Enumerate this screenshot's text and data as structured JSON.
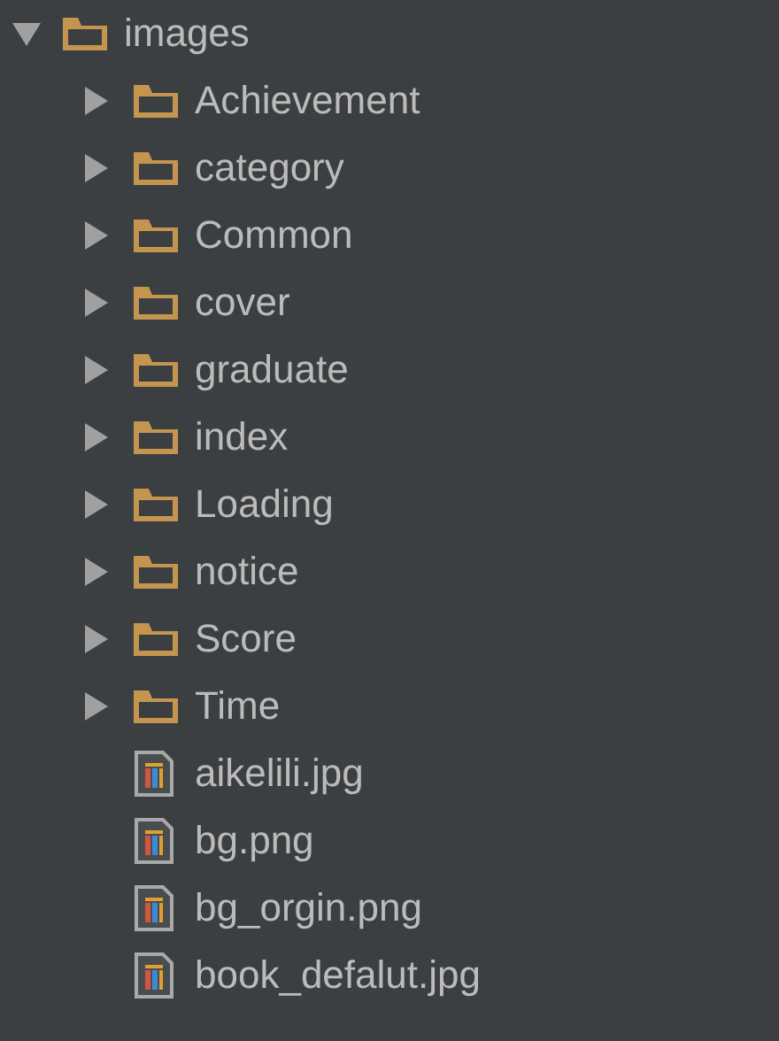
{
  "tree": [
    {
      "name": "images",
      "kind": "folder",
      "expanded": true,
      "children": [
        {
          "name": "Achievement",
          "kind": "folder",
          "expanded": false
        },
        {
          "name": "category",
          "kind": "folder",
          "expanded": false
        },
        {
          "name": "Common",
          "kind": "folder",
          "expanded": false
        },
        {
          "name": "cover",
          "kind": "folder",
          "expanded": false
        },
        {
          "name": "graduate",
          "kind": "folder",
          "expanded": false
        },
        {
          "name": "index",
          "kind": "folder",
          "expanded": false
        },
        {
          "name": "Loading",
          "kind": "folder",
          "expanded": false
        },
        {
          "name": "notice",
          "kind": "folder",
          "expanded": false
        },
        {
          "name": "Score",
          "kind": "folder",
          "expanded": false
        },
        {
          "name": "Time",
          "kind": "folder",
          "expanded": false
        },
        {
          "name": "aikelili.jpg",
          "kind": "file"
        },
        {
          "name": "bg.png",
          "kind": "file"
        },
        {
          "name": "bg_orgin.png",
          "kind": "file"
        },
        {
          "name": "book_defalut.jpg",
          "kind": "file"
        }
      ]
    }
  ]
}
